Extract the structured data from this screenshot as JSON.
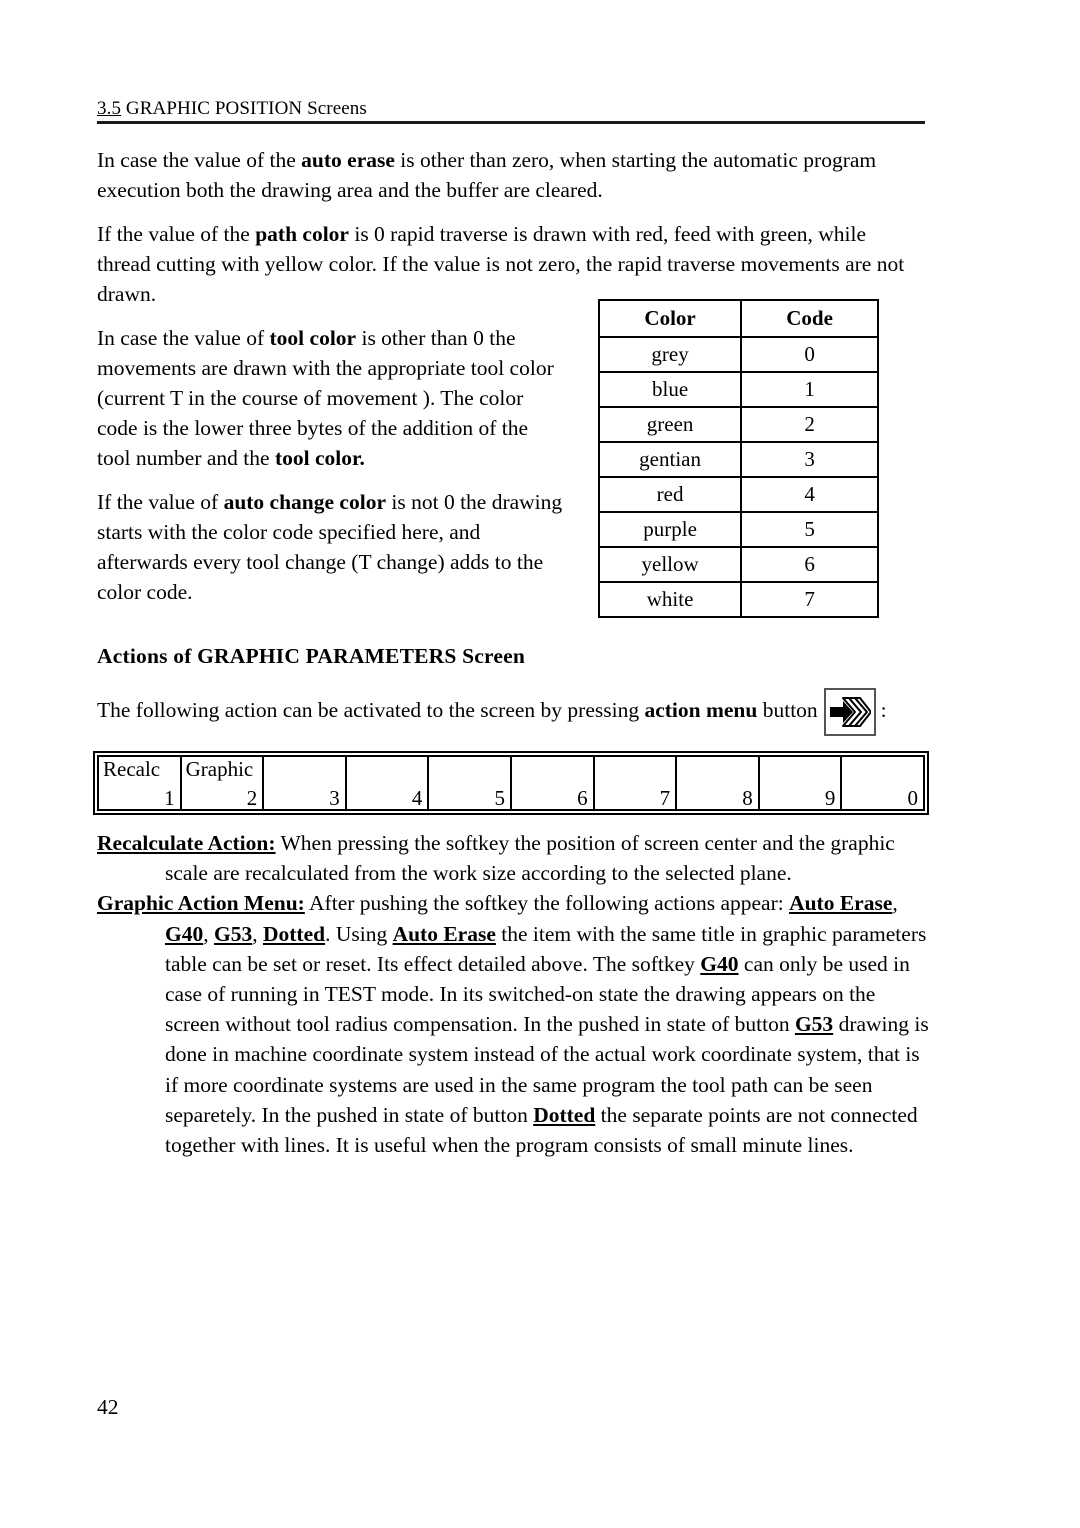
{
  "header": {
    "section_number": "3.5",
    "title": " GRAPHIC POSITION Screens"
  },
  "paragraphs": {
    "auto_erase_p1": "In case the value of the ",
    "auto_erase_bold": "auto erase",
    "auto_erase_p2": " is other than zero, when starting the automatic program execution both the drawing area and the buffer are cleared.",
    "path_color_p1": "If the value of the ",
    "path_color_bold": "path color",
    "path_color_p2": " is 0 rapid traverse is drawn with red, feed with green, while thread cutting with yellow color. If the value is not zero, the rapid traverse movements are not drawn.",
    "tool_color_p1": "In case the value of ",
    "tool_color_bold": "tool color",
    "tool_color_p2": " is other than 0 the movements are drawn with the appropriate tool color (current T in the course of movement ). The color code is the lower three bytes of the addition of the tool number and the ",
    "tool_color_bold2": "tool color.",
    "auto_change_p1": "If the value of ",
    "auto_change_bold": "auto change color",
    "auto_change_p2": " is not 0 the drawing starts with the color code specified here, and afterwards every tool change (T change) adds to the color code."
  },
  "color_table": {
    "headers": [
      "Color",
      "Code"
    ],
    "rows": [
      {
        "color": "grey",
        "code": "0"
      },
      {
        "color": "blue",
        "code": "1"
      },
      {
        "color": "green",
        "code": "2"
      },
      {
        "color": "gentian",
        "code": "3"
      },
      {
        "color": "red",
        "code": "4"
      },
      {
        "color": "purple",
        "code": "5"
      },
      {
        "color": "yellow",
        "code": "6"
      },
      {
        "color": "white",
        "code": "7"
      }
    ]
  },
  "subheading": "Actions of GRAPHIC PARAMETERS Screen",
  "action_line": {
    "before": "The following action can be activated to the screen by pressing ",
    "bold": "action menu",
    "middle": " button",
    "icon_name": "action-menu-icon",
    "after": ":"
  },
  "softkeys": [
    {
      "label": "Recalc",
      "num": "1"
    },
    {
      "label": "Graphic",
      "num": "2"
    },
    {
      "label": "",
      "num": "3"
    },
    {
      "label": "",
      "num": "4"
    },
    {
      "label": "",
      "num": "5"
    },
    {
      "label": "",
      "num": "6"
    },
    {
      "label": "",
      "num": "7"
    },
    {
      "label": "",
      "num": "8"
    },
    {
      "label": "",
      "num": "9"
    },
    {
      "label": "",
      "num": "0"
    }
  ],
  "definitions": {
    "recalc_term": "Recalculate Action:",
    "recalc_text": " When pressing the softkey the position of screen center and the graphic scale are recalculated from the work size according to the selected plane.",
    "graphic_term": "Graphic Action Menu:",
    "graphic_t1": " After pushing the softkey the following actions appear: ",
    "graphic_k1": "Auto Erase",
    "graphic_t2": ", ",
    "graphic_k2": "G40",
    "graphic_t3": ", ",
    "graphic_k3": "G53",
    "graphic_t4": ", ",
    "graphic_k4": "Dotted",
    "graphic_t5": ". Using ",
    "graphic_k5": "Auto Erase",
    "graphic_t6": " the item with the same title in graphic parameters table can be set or reset. Its effect detailed above. The softkey ",
    "graphic_k6": "G40",
    "graphic_t7": " can only be used in case of running in TEST mode. In its switched-on state the drawing appears on the screen without tool radius compensation. In the pushed in state of button ",
    "graphic_k7": "G53",
    "graphic_t8": " drawing is done in machine coordinate system instead of the actual work coordinate system, that is if more coordinate systems are used in the same program the tool path can be seen separetely. In the pushed in state of button ",
    "graphic_k8": "Dotted",
    "graphic_t9": " the separate points are not connected together with lines. It is useful when the program consists of small minute lines."
  },
  "page_number": "42"
}
